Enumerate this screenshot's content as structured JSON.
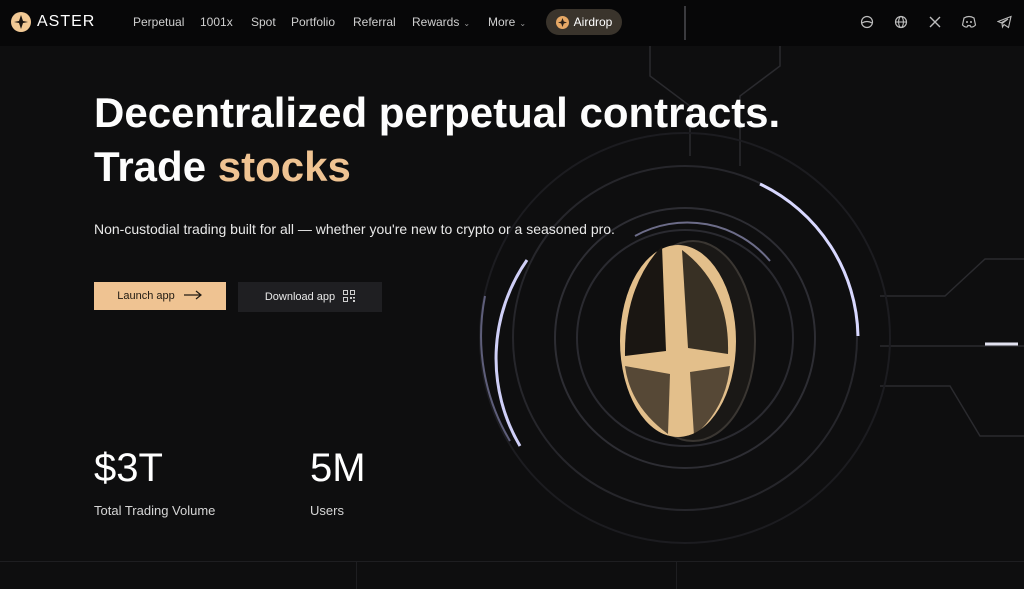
{
  "brand": {
    "name": "ASTER"
  },
  "nav": {
    "items": [
      {
        "label": "Perpetual"
      },
      {
        "label": "1001x"
      },
      {
        "label": "Spot"
      },
      {
        "label": "Portfolio"
      },
      {
        "label": "Referral"
      },
      {
        "label": "Rewards"
      },
      {
        "label": "More"
      }
    ],
    "airdrop_label": "Airdrop"
  },
  "hero": {
    "headline_line1": "Decentralized perpetual contracts.",
    "headline_line2_prefix": "Trade ",
    "headline_line2_accent": "stocks",
    "subtitle": "Non-custodial trading built for all — whether you're new to crypto or a seasoned pro.",
    "launch_label": "Launch app",
    "download_label": "Download app"
  },
  "stats": [
    {
      "value": "$3T",
      "label": "Total Trading Volume"
    },
    {
      "value": "5M",
      "label": "Users"
    }
  ],
  "socials": [
    "globe-icon",
    "language-icon",
    "x-icon",
    "discord-icon",
    "telegram-icon"
  ],
  "colors": {
    "accent": "#efc392",
    "background": "#0e0e0f",
    "nav_bg": "#070708"
  }
}
